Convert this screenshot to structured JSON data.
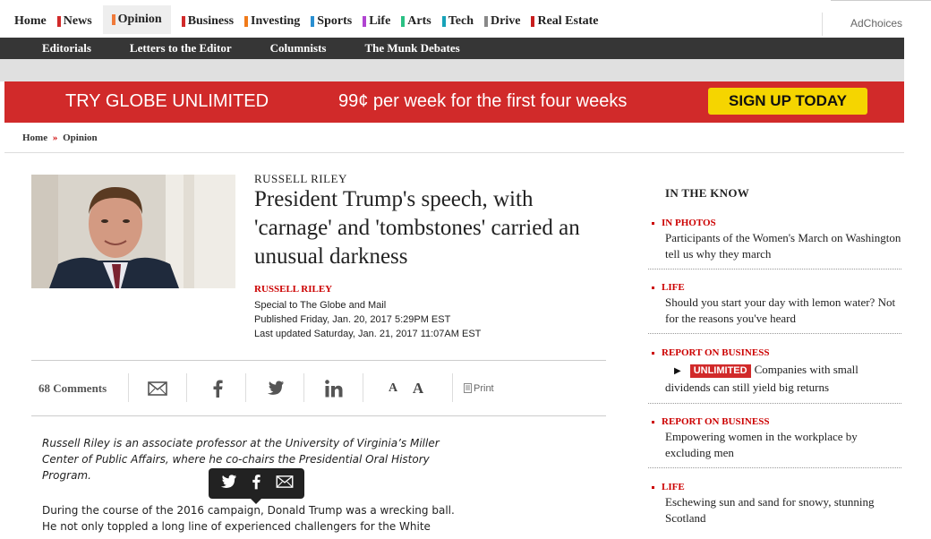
{
  "nav": {
    "items": [
      {
        "label": "Home",
        "color": ""
      },
      {
        "label": "News",
        "color": "#d12a2a"
      },
      {
        "label": "Opinion",
        "color": "#f07a3a",
        "active": true
      },
      {
        "label": "Business",
        "color": "#d12a2a"
      },
      {
        "label": "Investing",
        "color": "#f07a1a"
      },
      {
        "label": "Sports",
        "color": "#2a8fd1"
      },
      {
        "label": "Life",
        "color": "#b044d1"
      },
      {
        "label": "Arts",
        "color": "#2ac083"
      },
      {
        "label": "Tech",
        "color": "#17a2b8"
      },
      {
        "label": "Drive",
        "color": "#888888"
      },
      {
        "label": "Real Estate",
        "color": "#c81e1e"
      }
    ],
    "adchoices": "AdChoices"
  },
  "subnav": {
    "items": [
      "Editorials",
      "Letters to the Editor",
      "Columnists",
      "The Munk Debates"
    ]
  },
  "promo": {
    "headline": "TRY GLOBE UNLIMITED",
    "offer": "99¢ per week for the first four weeks",
    "button": "SIGN UP TODAY"
  },
  "breadcrumb": {
    "home": "Home",
    "sep": "»",
    "section": "Opinion"
  },
  "article": {
    "kicker": "RUSSELL RILEY",
    "headline": "President Trump's speech, with 'carnage' and 'tombstones' carried an unusual darkness",
    "byline": "RUSSELL RILEY",
    "special": "Special to The Globe and Mail",
    "published": "Published Friday, Jan. 20, 2017 5:29PM EST",
    "updated": "Last updated Saturday, Jan. 21, 2017 11:07AM EST",
    "lede": "Russell Riley is an associate professor at the University of Virginia’s Miller Center of Public Affairs, where he co-chairs the Presidential Oral History Program.",
    "para1": "During the course of the 2016 campaign, Donald Trump was a wrecking ball. He not only toppled a long line of experienced challengers for the White"
  },
  "sharebar": {
    "comments": "68 Comments",
    "font_small": "A",
    "font_large": "A",
    "print": "Print"
  },
  "sidebar": {
    "title": "IN THE KNOW",
    "items": [
      {
        "section": "IN PHOTOS",
        "title": "Participants of the Women's March on Washington tell us why they march"
      },
      {
        "section": "LIFE",
        "title": "Should you start your day with lemon water? Not for the reasons you've heard"
      },
      {
        "section": "REPORT ON BUSINESS",
        "badge": "UNLIMITED",
        "title": "Companies with small dividends can still yield big returns"
      },
      {
        "section": "REPORT ON BUSINESS",
        "title": "Empowering women in the workplace by excluding men"
      },
      {
        "section": "LIFE",
        "title": "Eschewing sun and sand for snowy, stunning Scotland"
      }
    ]
  }
}
